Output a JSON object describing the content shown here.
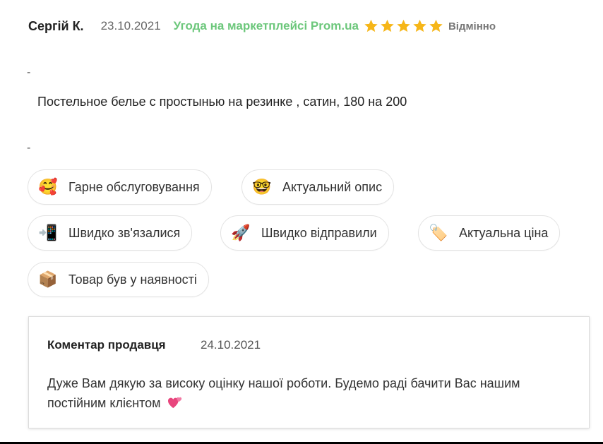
{
  "review": {
    "author": "Сергій К.",
    "date": "23.10.2021",
    "deal": "Угода на маркетплейсі Prom.ua",
    "stars": 5,
    "rating_label": "Відмінно",
    "dash_1": "-",
    "product": "Постельное белье с простынью на резинке , сатин, 180 на 200",
    "dash_2": "-"
  },
  "tags": [
    {
      "emoji": "🥰",
      "label": "Гарне обслуговування"
    },
    {
      "emoji": "🤓",
      "label": "Актуальний опис"
    },
    {
      "emoji": "📲",
      "label": "Швидко зв'язалися"
    },
    {
      "emoji": "🚀",
      "label": "Швидко відправили"
    },
    {
      "emoji": "🏷️",
      "label": "Актуальна ціна"
    },
    {
      "emoji": "📦",
      "label": "Товар був у наявності"
    }
  ],
  "seller_comment": {
    "title": "Коментар продавця",
    "date": "24.10.2021",
    "text": "Дуже Вам дякую за високу оцінку нашої роботи. Будемо раді бачити Вас нашим постійним клієнтом"
  },
  "icons": {
    "star": "star-icon",
    "heart": "two-hearts-icon"
  },
  "colors": {
    "deal_green": "#6cc77b",
    "star_gold": "#f6b618",
    "heart_pink": "#e8457d"
  }
}
